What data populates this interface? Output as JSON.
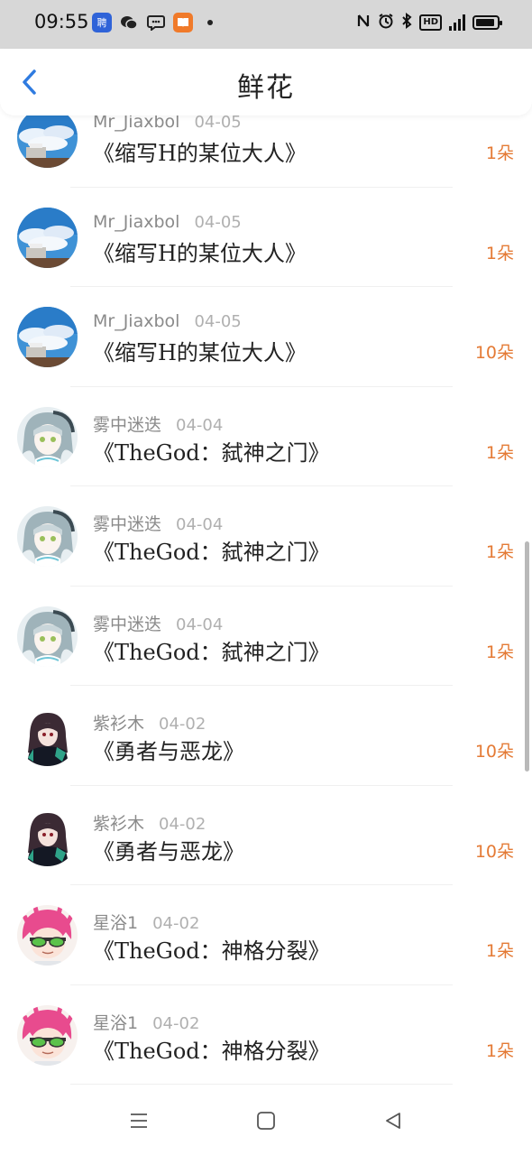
{
  "status_bar": {
    "time": "09:55",
    "app_icons": [
      "聘",
      "wechat-icon",
      "message-icon",
      "book-app-icon"
    ],
    "right_icons": [
      "nfc-icon",
      "alarm-icon",
      "bluetooth-icon",
      "hd-icon",
      "signal-4g-icon",
      "battery-icon"
    ],
    "hd_label": "HD"
  },
  "header": {
    "title": "鲜花",
    "back_icon": "chevron-left-icon",
    "accent": "#2f7be0"
  },
  "list": [
    {
      "name": "Mr_Jiaxbol",
      "date": "04-05",
      "work": "《缩写H的某位大人》",
      "amount": "1朵",
      "avatar": "sky-avatar"
    },
    {
      "name": "Mr_Jiaxbol",
      "date": "04-05",
      "work": "《缩写H的某位大人》",
      "amount": "1朵",
      "avatar": "sky-avatar"
    },
    {
      "name": "Mr_Jiaxbol",
      "date": "04-05",
      "work": "《缩写H的某位大人》",
      "amount": "10朵",
      "avatar": "sky-avatar"
    },
    {
      "name": "雾中迷迭",
      "date": "04-04",
      "work": "《TheGod：弑神之门》",
      "amount": "1朵",
      "avatar": "silver-hair-avatar"
    },
    {
      "name": "雾中迷迭",
      "date": "04-04",
      "work": "《TheGod：弑神之门》",
      "amount": "1朵",
      "avatar": "silver-hair-avatar"
    },
    {
      "name": "雾中迷迭",
      "date": "04-04",
      "work": "《TheGod：弑神之门》",
      "amount": "1朵",
      "avatar": "silver-hair-avatar"
    },
    {
      "name": "紫衫木",
      "date": "04-02",
      "work": "《勇者与恶龙》",
      "amount": "10朵",
      "avatar": "dark-hair-avatar"
    },
    {
      "name": "紫衫木",
      "date": "04-02",
      "work": "《勇者与恶龙》",
      "amount": "10朵",
      "avatar": "dark-hair-avatar"
    },
    {
      "name": "星浴1",
      "date": "04-02",
      "work": "《TheGod：神格分裂》",
      "amount": "1朵",
      "avatar": "pink-hair-avatar"
    },
    {
      "name": "星浴1",
      "date": "04-02",
      "work": "《TheGod：神格分裂》",
      "amount": "1朵",
      "avatar": "pink-hair-avatar"
    }
  ],
  "colors": {
    "amount": "#e47a35",
    "name": "#8a8a8a",
    "date": "#b0b0b0",
    "status_bg": "#d7d7d7"
  },
  "bottom_nav": [
    "menu-icon",
    "home-square-icon",
    "back-triangle-icon"
  ]
}
